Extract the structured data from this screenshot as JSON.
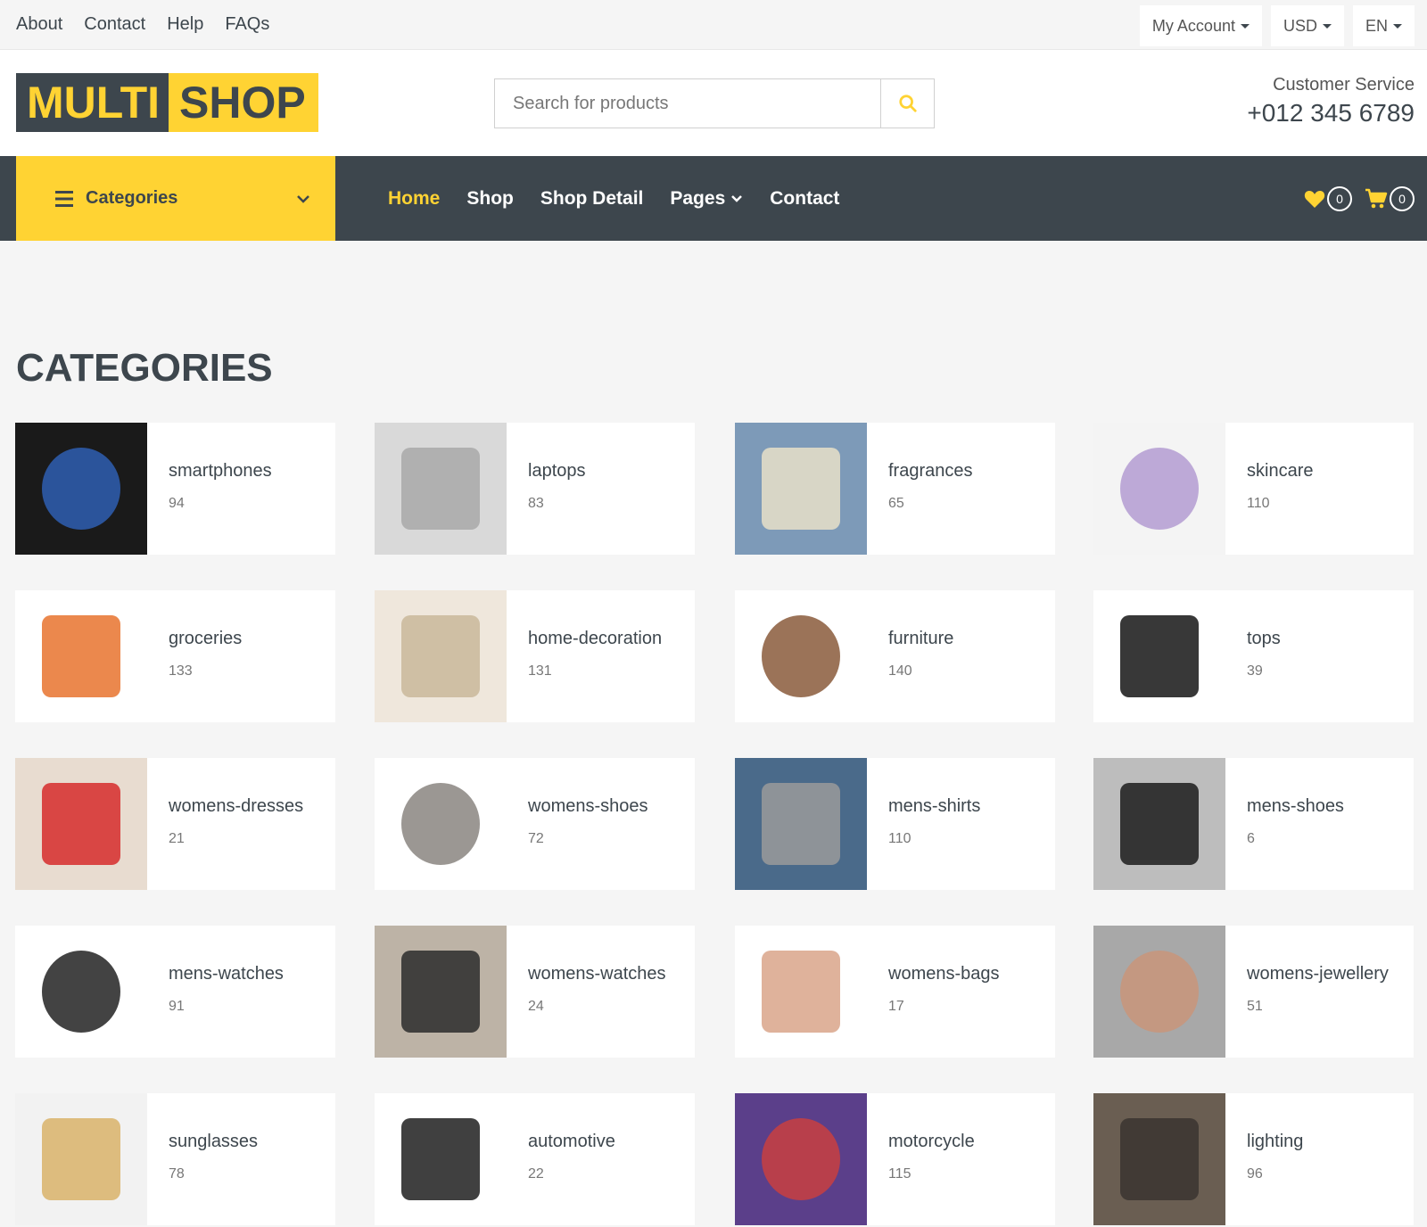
{
  "topbar": {
    "links": [
      "About",
      "Contact",
      "Help",
      "FAQs"
    ],
    "account": "My Account",
    "currency": "USD",
    "language": "EN"
  },
  "header": {
    "logo_part1": "MULTI",
    "logo_part2": "SHOP",
    "search_placeholder": "Search for products",
    "cs_label": "Customer Service",
    "cs_phone": "+012 345 6789"
  },
  "navbar": {
    "categories_label": "Categories",
    "links": [
      "Home",
      "Shop",
      "Shop Detail",
      "Pages",
      "Contact"
    ],
    "wishlist_count": "0",
    "cart_count": "0"
  },
  "section_title": "CATEGORIES",
  "categories": [
    {
      "name": "smartphones",
      "count": "94"
    },
    {
      "name": "laptops",
      "count": "83"
    },
    {
      "name": "fragrances",
      "count": "65"
    },
    {
      "name": "skincare",
      "count": "110"
    },
    {
      "name": "groceries",
      "count": "133"
    },
    {
      "name": "home-decoration",
      "count": "131"
    },
    {
      "name": "furniture",
      "count": "140"
    },
    {
      "name": "tops",
      "count": "39"
    },
    {
      "name": "womens-dresses",
      "count": "21"
    },
    {
      "name": "womens-shoes",
      "count": "72"
    },
    {
      "name": "mens-shirts",
      "count": "110"
    },
    {
      "name": "mens-shoes",
      "count": "6"
    },
    {
      "name": "mens-watches",
      "count": "91"
    },
    {
      "name": "womens-watches",
      "count": "24"
    },
    {
      "name": "womens-bags",
      "count": "17"
    },
    {
      "name": "womens-jewellery",
      "count": "51"
    },
    {
      "name": "sunglasses",
      "count": "78"
    },
    {
      "name": "automotive",
      "count": "22"
    },
    {
      "name": "motorcycle",
      "count": "115"
    },
    {
      "name": "lighting",
      "count": "96"
    }
  ],
  "colors": {
    "accent": "#ffd333",
    "dark": "#3d464d"
  }
}
